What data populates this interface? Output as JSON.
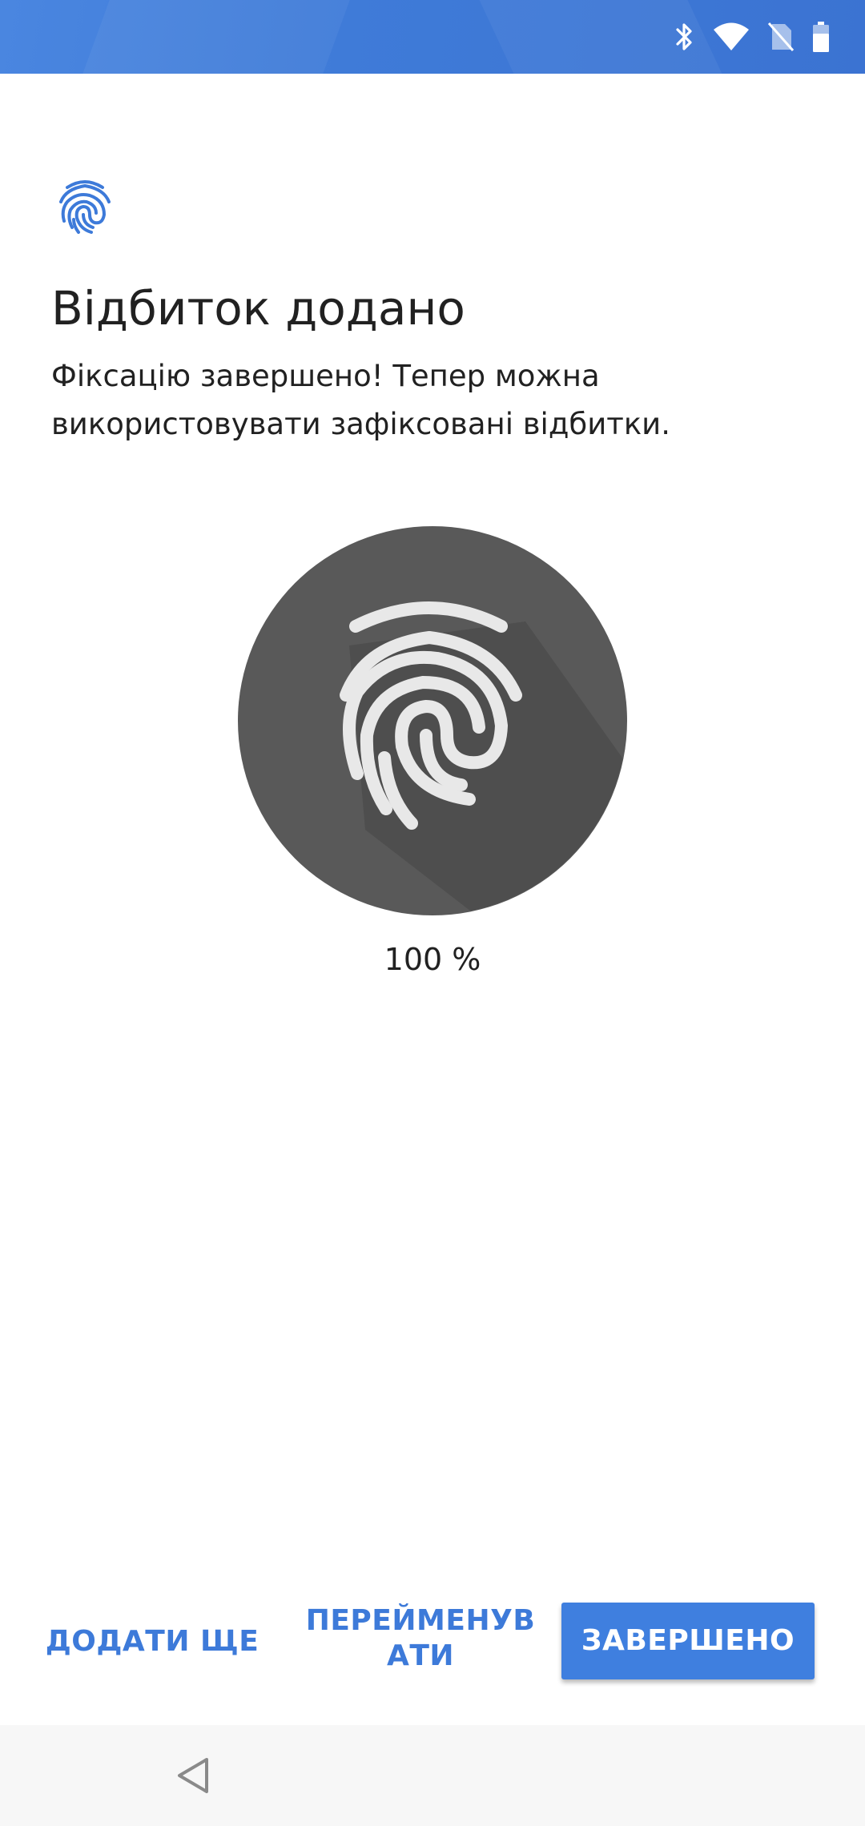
{
  "status_bar": {
    "background_color": "#3f7bd8",
    "icons": [
      "bluetooth-icon",
      "wifi-icon",
      "no-sim-icon",
      "battery-icon"
    ]
  },
  "header": {
    "icon": "fingerprint-icon",
    "icon_color": "#3d7ad9",
    "title": "Відбиток додано",
    "description": "Фіксацію завершено! Тепер можна використовувати зафіксовані відбитки."
  },
  "progress": {
    "icon": "fingerprint-icon",
    "circle_color": "#555555",
    "percent": 100,
    "percent_label": "100 %"
  },
  "buttons": {
    "add_more": "ДОДАТИ ЩЕ",
    "rename": "ПЕРЕЙМЕНУВАТИ",
    "done": "ЗАВЕРШЕНО",
    "accent_color": "#3f7fdf"
  },
  "nav_bar": {
    "back_icon": "back-triangle-icon"
  }
}
